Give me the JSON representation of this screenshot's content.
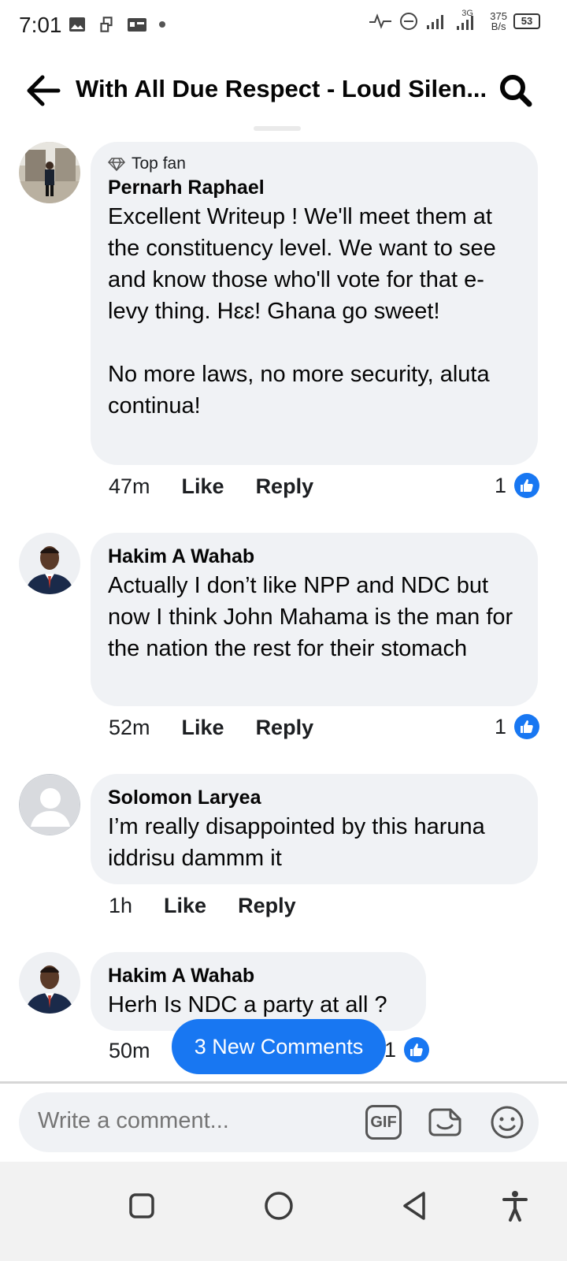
{
  "status_bar": {
    "time": "7:01",
    "network_type": "3G",
    "speed_value": "375",
    "speed_unit": "B/s",
    "battery": "53"
  },
  "header": {
    "title": "With All Due Respect - Loud Silen..."
  },
  "comments": [
    {
      "badge": "Top fan",
      "author": "Pernarh Raphael",
      "text": "Excellent Writeup ! We'll meet them at the constituency level. We want to see and know those who'll vote for that e-levy thing. Hɛɛ! Ghana go sweet!\n\nNo more laws, no more security, aluta continua!",
      "time": "47m",
      "like_label": "Like",
      "reply_label": "Reply",
      "reaction_count": "1"
    },
    {
      "author": "Hakim A Wahab",
      "text": "Actually I don’t like NPP and NDC but now I think John Mahama is the man for the nation the rest for their stomach",
      "time": "52m",
      "like_label": "Like",
      "reply_label": "Reply",
      "reaction_count": "1"
    },
    {
      "author": "Solomon Laryea",
      "text": "I’m really disappointed by this haruna iddrisu dammm it",
      "time": "1h",
      "like_label": "Like",
      "reply_label": "Reply"
    },
    {
      "author": "Hakim A Wahab",
      "text": "Herh Is NDC a party at all ?",
      "time": "50m",
      "reaction_count": "1"
    }
  ],
  "new_comments_pill": "3 New Comments",
  "composer": {
    "placeholder": "Write a comment...",
    "gif_label": "GIF"
  },
  "colors": {
    "accent": "#1877f2",
    "bubble": "#f0f2f5"
  },
  "icons": [
    "image-icon",
    "link-icon",
    "radio-icon",
    "dot-icon",
    "activity-icon",
    "dnd-icon",
    "signal-icon",
    "battery-icon",
    "back-arrow-icon",
    "search-icon",
    "diamond-icon",
    "like-icon",
    "sticker-icon",
    "emoji-icon",
    "square-icon",
    "circle-icon",
    "triangle-icon",
    "accessibility-icon"
  ]
}
